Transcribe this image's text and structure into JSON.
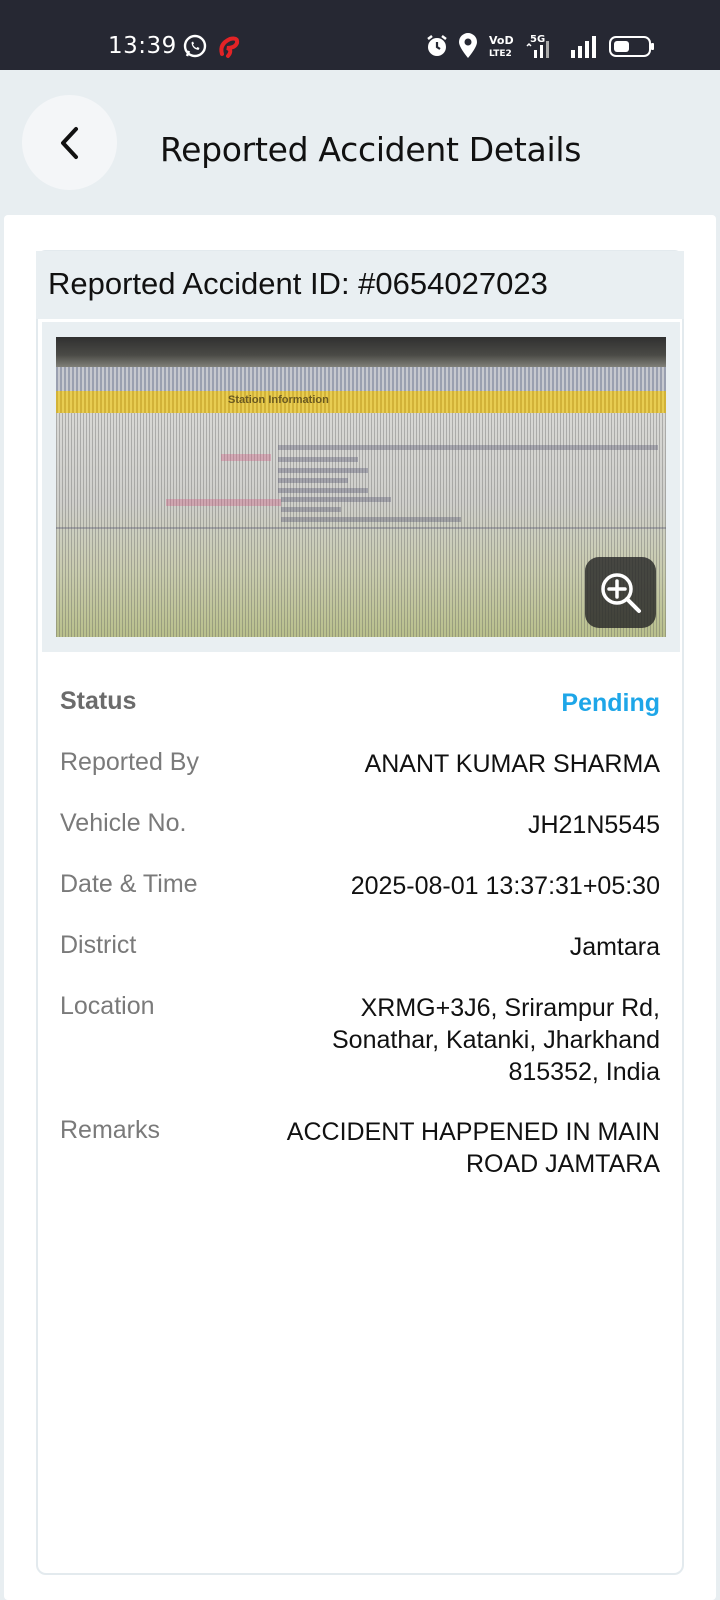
{
  "status_bar": {
    "time": "13:39"
  },
  "header": {
    "title": "Reported Accident Details"
  },
  "card": {
    "id_label": "Reported Accident ID: #0654027023",
    "photo_band_text": "Station Information"
  },
  "details": {
    "status": {
      "label": "Status",
      "value": "Pending",
      "color": "#1ea6e8"
    },
    "reported_by": {
      "label": "Reported By",
      "value": "ANANT KUMAR SHARMA"
    },
    "vehicle_no": {
      "label": "Vehicle No.",
      "value": "JH21N5545"
    },
    "date_time": {
      "label": "Date & Time",
      "value": "2025-08-01 13:37:31+05:30"
    },
    "district": {
      "label": "District",
      "value": "Jamtara"
    },
    "location": {
      "label": "Location",
      "line1": "XRMG+3J6, Srirampur Rd,",
      "line2": "Sonathar, Katanki, Jharkhand",
      "line3": "815352, India"
    },
    "remarks": {
      "label": "Remarks",
      "line1": "ACCIDENT HAPPENED IN MAIN",
      "line2": "ROAD JAMTARA"
    }
  },
  "icons": {
    "whatsapp": "whatsapp-icon",
    "airtel": "airtel-icon",
    "alarm": "alarm-icon",
    "location": "location-pin-icon",
    "volte": "volte-icon",
    "signal5g": "signal-5g-icon",
    "signal": "signal-icon",
    "battery": "battery-icon",
    "back": "chevron-left-icon",
    "zoom": "zoom-in-icon"
  }
}
